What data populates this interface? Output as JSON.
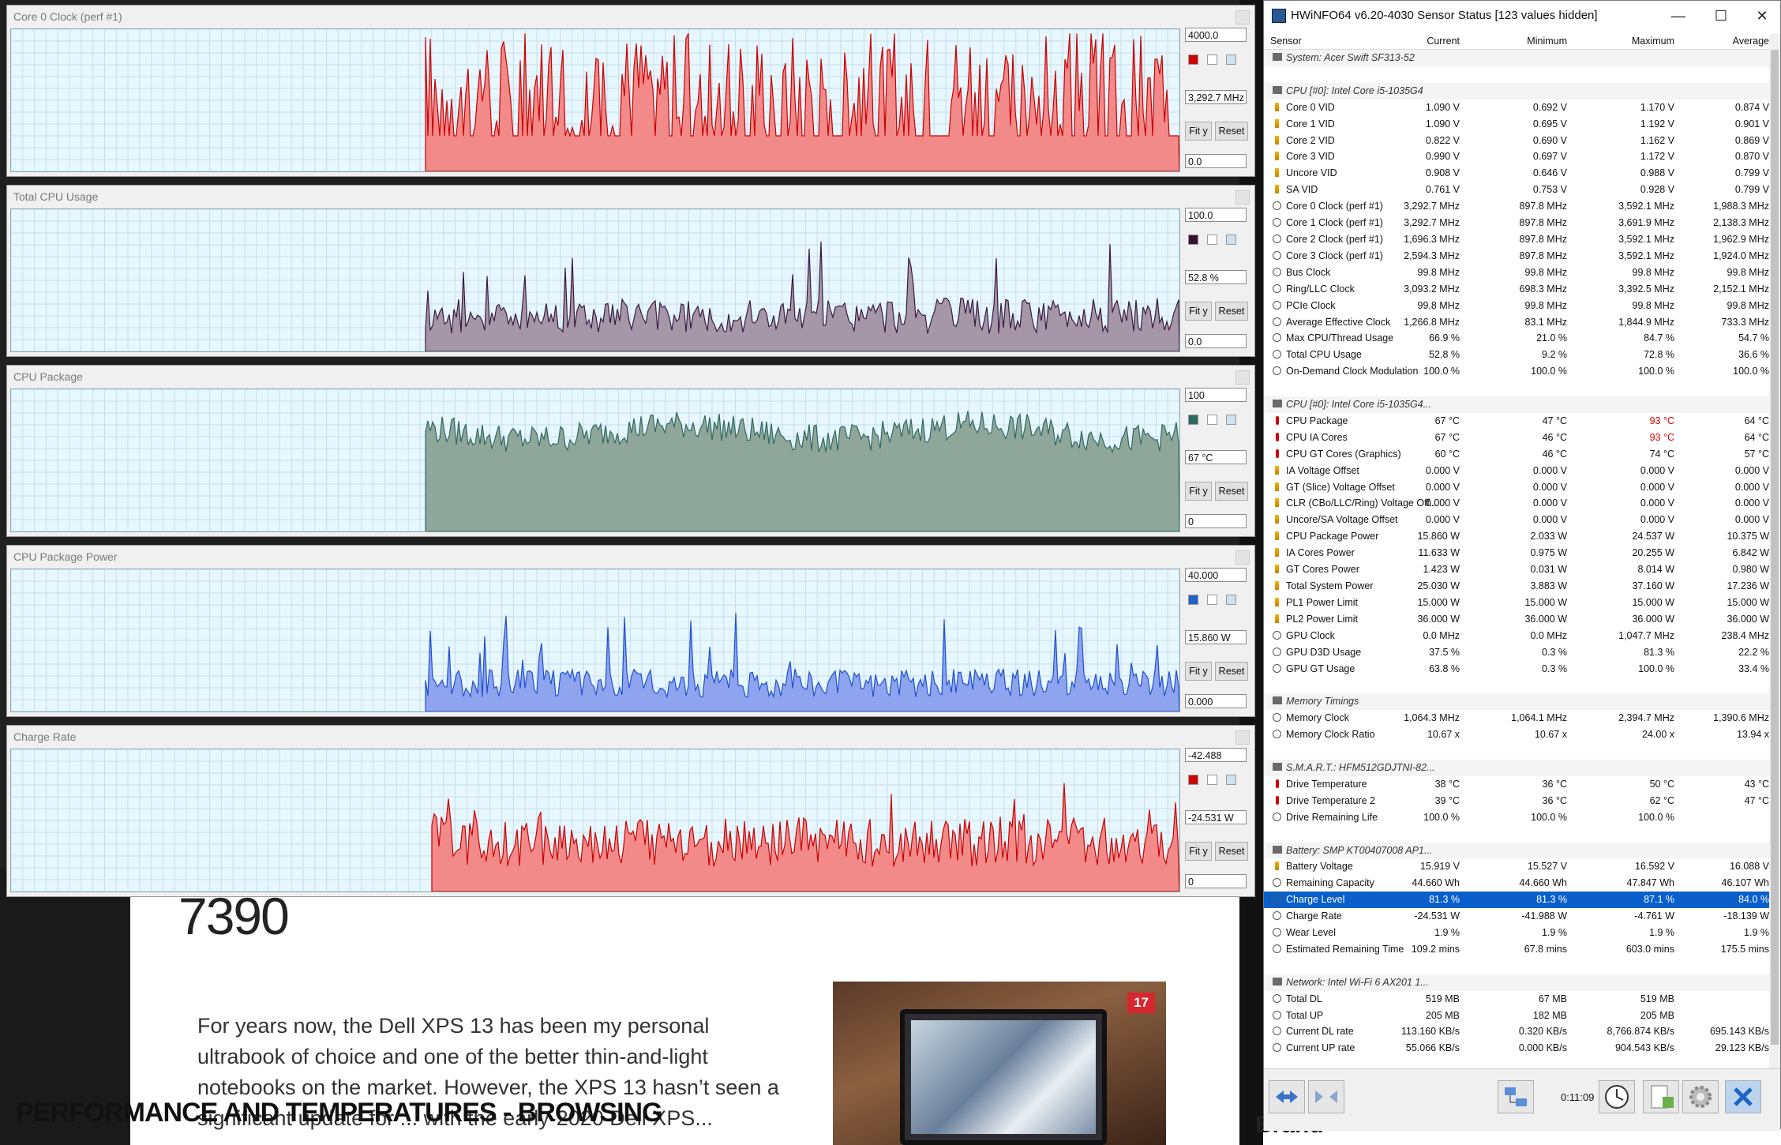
{
  "background": {
    "article_title": "7390",
    "article_text": "For years now, the Dell XPS 13 has been my personal ultrabook of choice and one of the better thin-and-light notebooks on the market. However, the XPS 13 hasn’t seen a significant update for ... with the early-2020 Dell XPS...",
    "image_badge": "17",
    "section_caption": "PERFORMANCE AND TEMPERATURES - BROWSING",
    "brand_label": "Brand"
  },
  "graphs": [
    {
      "title": "Core 0 Clock (perf #1)",
      "max": "4000.0",
      "current": "3,292.7 MHz",
      "min": "0.0",
      "fill": "#f38a8a",
      "stroke": "#c80000",
      "swatch": "#cc0000"
    },
    {
      "title": "Total CPU Usage",
      "max": "100.0",
      "current": "52.8 %",
      "min": "0.0",
      "fill": "#a596a8",
      "stroke": "#3a1a40",
      "swatch": "#3a1030"
    },
    {
      "title": "CPU Package",
      "max": "100",
      "current": "67 °C",
      "min": "0",
      "fill": "#8fa69b",
      "stroke": "#2f6a5e",
      "swatch": "#2b6a60"
    },
    {
      "title": "CPU Package Power",
      "max": "40.000",
      "current": "15.860 W",
      "min": "0.000",
      "fill": "#8fa4ee",
      "stroke": "#1f4fd0",
      "swatch": "#1f62c8"
    },
    {
      "title": "Charge Rate",
      "max": "-42.488",
      "current": "-24.531 W",
      "min": "0",
      "fill": "#f38a8a",
      "stroke": "#c80000",
      "swatch": "#cc0000"
    }
  ],
  "graph_buttons": {
    "fit": "Fit y",
    "reset": "Reset"
  },
  "hwinfo": {
    "title": "HWiNFO64 v6.20-4030 Sensor Status [123 values hidden]",
    "columns": [
      "Sensor",
      "Current",
      "Minimum",
      "Maximum",
      "Average"
    ],
    "rows": [
      {
        "t": "hdr",
        "icon": "dev",
        "n": "System: Acer Swift SF313-52"
      },
      {
        "t": "blank"
      },
      {
        "t": "hdr",
        "icon": "dev",
        "n": "CPU [#0]: Intel Core i5-1035G4"
      },
      {
        "icon": "volt",
        "n": "Core 0 VID",
        "c": "1.090 V",
        "mi": "0.692 V",
        "ma": "1.170 V",
        "a": "0.874 V"
      },
      {
        "icon": "volt",
        "n": "Core 1 VID",
        "c": "1.090 V",
        "mi": "0.695 V",
        "ma": "1.192 V",
        "a": "0.901 V"
      },
      {
        "icon": "volt",
        "n": "Core 2 VID",
        "c": "0.822 V",
        "mi": "0.690 V",
        "ma": "1.162 V",
        "a": "0.869 V"
      },
      {
        "icon": "volt",
        "n": "Core 3 VID",
        "c": "0.990 V",
        "mi": "0.697 V",
        "ma": "1.172 V",
        "a": "0.870 V"
      },
      {
        "icon": "volt",
        "n": "Uncore VID",
        "c": "0.908 V",
        "mi": "0.646 V",
        "ma": "0.988 V",
        "a": "0.799 V"
      },
      {
        "icon": "volt",
        "n": "SA VID",
        "c": "0.761 V",
        "mi": "0.753 V",
        "ma": "0.928 V",
        "a": "0.799 V"
      },
      {
        "icon": "clock",
        "n": "Core 0 Clock (perf #1)",
        "c": "3,292.7 MHz",
        "mi": "897.8 MHz",
        "ma": "3,592.1 MHz",
        "a": "1,988.3 MHz"
      },
      {
        "icon": "clock",
        "n": "Core 1 Clock (perf #1)",
        "c": "3,292.7 MHz",
        "mi": "897.8 MHz",
        "ma": "3,691.9 MHz",
        "a": "2,138.3 MHz"
      },
      {
        "icon": "clock",
        "n": "Core 2 Clock (perf #1)",
        "c": "1,696.3 MHz",
        "mi": "897.8 MHz",
        "ma": "3,592.1 MHz",
        "a": "1,962.9 MHz"
      },
      {
        "icon": "clock",
        "n": "Core 3 Clock (perf #1)",
        "c": "2,594.3 MHz",
        "mi": "897.8 MHz",
        "ma": "3,592.1 MHz",
        "a": "1,924.0 MHz"
      },
      {
        "icon": "clock",
        "n": "Bus Clock",
        "c": "99.8 MHz",
        "mi": "99.8 MHz",
        "ma": "99.8 MHz",
        "a": "99.8 MHz"
      },
      {
        "icon": "clock",
        "n": "Ring/LLC Clock",
        "c": "3,093.2 MHz",
        "mi": "698.3 MHz",
        "ma": "3,392.5 MHz",
        "a": "2,152.1 MHz"
      },
      {
        "icon": "clock",
        "n": "PCIe Clock",
        "c": "99.8 MHz",
        "mi": "99.8 MHz",
        "ma": "99.8 MHz",
        "a": "99.8 MHz"
      },
      {
        "icon": "clock",
        "n": "Average Effective Clock",
        "c": "1,266.8 MHz",
        "mi": "83.1 MHz",
        "ma": "1,844.9 MHz",
        "a": "733.3 MHz"
      },
      {
        "icon": "clock",
        "n": "Max CPU/Thread Usage",
        "c": "66.9 %",
        "mi": "21.0 %",
        "ma": "84.7 %",
        "a": "54.7 %"
      },
      {
        "icon": "clock",
        "n": "Total CPU Usage",
        "c": "52.8 %",
        "mi": "9.2 %",
        "ma": "72.8 %",
        "a": "36.6 %"
      },
      {
        "icon": "clock",
        "n": "On-Demand Clock Modulation",
        "c": "100.0 %",
        "mi": "100.0 %",
        "ma": "100.0 %",
        "a": "100.0 %"
      },
      {
        "t": "blank"
      },
      {
        "t": "hdr",
        "icon": "dev",
        "n": "CPU [#0]: Intel Core i5-1035G4..."
      },
      {
        "icon": "temp",
        "n": "CPU Package",
        "c": "67 °C",
        "mi": "47 °C",
        "ma": "93 °C",
        "a": "64 °C",
        "hot": true
      },
      {
        "icon": "temp",
        "n": "CPU IA Cores",
        "c": "67 °C",
        "mi": "46 °C",
        "ma": "93 °C",
        "a": "64 °C",
        "hot": true
      },
      {
        "icon": "temp",
        "n": "CPU GT Cores (Graphics)",
        "c": "60 °C",
        "mi": "46 °C",
        "ma": "74 °C",
        "a": "57 °C"
      },
      {
        "icon": "volt",
        "n": "IA Voltage Offset",
        "c": "0.000 V",
        "mi": "0.000 V",
        "ma": "0.000 V",
        "a": "0.000 V"
      },
      {
        "icon": "volt",
        "n": "GT (Slice) Voltage Offset",
        "c": "0.000 V",
        "mi": "0.000 V",
        "ma": "0.000 V",
        "a": "0.000 V"
      },
      {
        "icon": "volt",
        "n": "CLR (CBo/LLC/Ring) Voltage Off...",
        "c": "0.000 V",
        "mi": "0.000 V",
        "ma": "0.000 V",
        "a": "0.000 V"
      },
      {
        "icon": "volt",
        "n": "Uncore/SA Voltage Offset",
        "c": "0.000 V",
        "mi": "0.000 V",
        "ma": "0.000 V",
        "a": "0.000 V"
      },
      {
        "icon": "volt",
        "n": "CPU Package Power",
        "c": "15.860 W",
        "mi": "2.033 W",
        "ma": "24.537 W",
        "a": "10.375 W"
      },
      {
        "icon": "volt",
        "n": "IA Cores Power",
        "c": "11.633 W",
        "mi": "0.975 W",
        "ma": "20.255 W",
        "a": "6.842 W"
      },
      {
        "icon": "volt",
        "n": "GT Cores Power",
        "c": "1.423 W",
        "mi": "0.031 W",
        "ma": "8.014 W",
        "a": "0.980 W"
      },
      {
        "icon": "volt",
        "n": "Total System Power",
        "c": "25.030 W",
        "mi": "3.883 W",
        "ma": "37.160 W",
        "a": "17.236 W"
      },
      {
        "icon": "volt",
        "n": "PL1 Power Limit",
        "c": "15.000 W",
        "mi": "15.000 W",
        "ma": "15.000 W",
        "a": "15.000 W"
      },
      {
        "icon": "volt",
        "n": "PL2 Power Limit",
        "c": "36.000 W",
        "mi": "36.000 W",
        "ma": "36.000 W",
        "a": "36.000 W"
      },
      {
        "icon": "clock",
        "n": "GPU Clock",
        "c": "0.0 MHz",
        "mi": "0.0 MHz",
        "ma": "1,047.7 MHz",
        "a": "238.4 MHz"
      },
      {
        "icon": "clock",
        "n": "GPU D3D Usage",
        "c": "37.5 %",
        "mi": "0.3 %",
        "ma": "81.3 %",
        "a": "22.2 %"
      },
      {
        "icon": "clock",
        "n": "GPU GT Usage",
        "c": "63.8 %",
        "mi": "0.3 %",
        "ma": "100.0 %",
        "a": "33.4 %"
      },
      {
        "t": "blank"
      },
      {
        "t": "hdr",
        "icon": "dev",
        "n": "Memory Timings"
      },
      {
        "icon": "clock",
        "n": "Memory Clock",
        "c": "1,064.3 MHz",
        "mi": "1,064.1 MHz",
        "ma": "2,394.7 MHz",
        "a": "1,390.6 MHz"
      },
      {
        "icon": "clock",
        "n": "Memory Clock Ratio",
        "c": "10.67 x",
        "mi": "10.67 x",
        "ma": "24.00 x",
        "a": "13.94 x"
      },
      {
        "t": "blank"
      },
      {
        "t": "hdr",
        "icon": "dev",
        "n": "S.M.A.R.T.: HFM512GDJTNI-82..."
      },
      {
        "icon": "temp",
        "n": "Drive Temperature",
        "c": "38 °C",
        "mi": "36 °C",
        "ma": "50 °C",
        "a": "43 °C"
      },
      {
        "icon": "temp",
        "n": "Drive Temperature 2",
        "c": "39 °C",
        "mi": "36 °C",
        "ma": "62 °C",
        "a": "47 °C"
      },
      {
        "icon": "clock",
        "n": "Drive Remaining Life",
        "c": "100.0 %",
        "mi": "100.0 %",
        "ma": "100.0 %",
        "a": ""
      },
      {
        "t": "blank"
      },
      {
        "t": "hdr",
        "icon": "dev",
        "n": "Battery: SMP KT00407008 AP1..."
      },
      {
        "icon": "volt",
        "n": "Battery Voltage",
        "c": "15.919 V",
        "mi": "15.527 V",
        "ma": "16.592 V",
        "a": "16.088 V"
      },
      {
        "icon": "clock",
        "n": "Remaining Capacity",
        "c": "44.660 Wh",
        "mi": "44.660 Wh",
        "ma": "47.847 Wh",
        "a": "46.107 Wh"
      },
      {
        "icon": "clock",
        "n": "Charge Level",
        "c": "81.3 %",
        "mi": "81.3 %",
        "ma": "87.1 %",
        "a": "84.0 %",
        "sel": true
      },
      {
        "icon": "clock",
        "n": "Charge Rate",
        "c": "-24.531 W",
        "mi": "-41.988 W",
        "ma": "-4.761 W",
        "a": "-18.139 W"
      },
      {
        "icon": "clock",
        "n": "Wear Level",
        "c": "1.9 %",
        "mi": "1.9 %",
        "ma": "1.9 %",
        "a": "1.9 %"
      },
      {
        "icon": "clock",
        "n": "Estimated Remaining Time",
        "c": "109.2 mins",
        "mi": "67.8 mins",
        "ma": "603.0 mins",
        "a": "175.5 mins"
      },
      {
        "t": "blank"
      },
      {
        "t": "hdr",
        "icon": "dev",
        "n": "Network: Intel Wi-Fi 6 AX201 1..."
      },
      {
        "icon": "clock",
        "n": "Total DL",
        "c": "519 MB",
        "mi": "67 MB",
        "ma": "519 MB",
        "a": ""
      },
      {
        "icon": "clock",
        "n": "Total UP",
        "c": "205 MB",
        "mi": "182 MB",
        "ma": "205 MB",
        "a": ""
      },
      {
        "icon": "clock",
        "n": "Current DL rate",
        "c": "113.160 KB/s",
        "mi": "0.320 KB/s",
        "ma": "8,766.874 KB/s",
        "a": "695.143 KB/s"
      },
      {
        "icon": "clock",
        "n": "Current UP rate",
        "c": "55.066 KB/s",
        "mi": "0.000 KB/s",
        "ma": "904.543 KB/s",
        "a": "29.123 KB/s"
      }
    ],
    "elapsed": "0:11:09"
  }
}
